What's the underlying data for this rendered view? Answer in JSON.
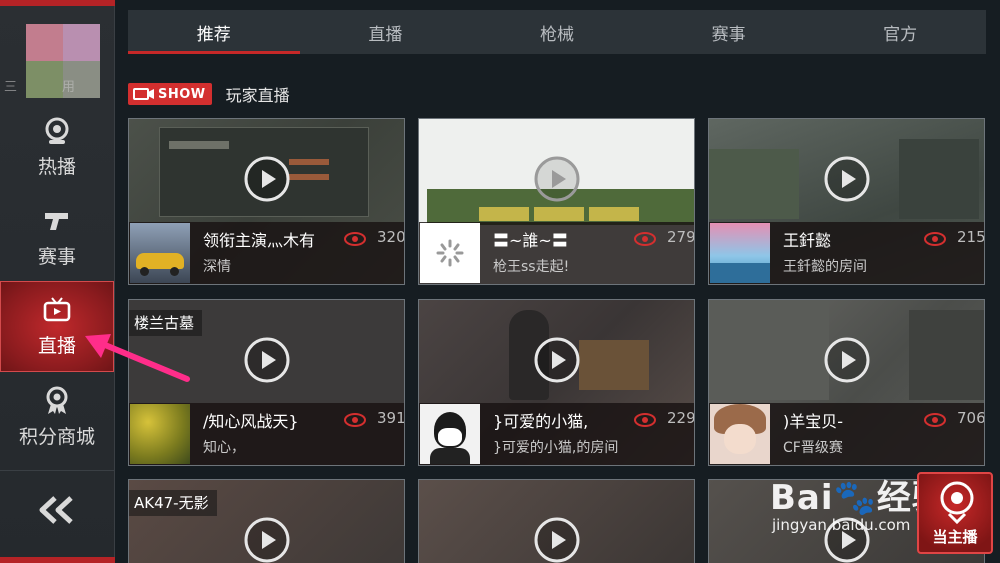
{
  "sidebar": {
    "avatar_name": "三       用",
    "items": [
      {
        "label": "热播",
        "icon": "webcam-icon"
      },
      {
        "label": "赛事",
        "icon": "pistol-icon"
      },
      {
        "label": "直播",
        "icon": "tv-icon",
        "active": true
      },
      {
        "label": "积分商城",
        "icon": "medal-icon"
      }
    ],
    "collapse_icon": "double-chevron-left-icon"
  },
  "tabs": [
    {
      "label": "推荐",
      "active": true
    },
    {
      "label": "直播"
    },
    {
      "label": "枪械"
    },
    {
      "label": "赛事"
    },
    {
      "label": "官方"
    }
  ],
  "section": {
    "badge": "SHOW",
    "title": "玩家直播"
  },
  "cards": [
    {
      "title": "领衔主演灬木有",
      "subtitle": "深情",
      "views": "320"
    },
    {
      "title": "〓~誰~〓",
      "subtitle": "枪王ss走起!",
      "views": "279"
    },
    {
      "title": "王釺懿",
      "subtitle": "王釺懿的房间",
      "views": "215"
    },
    {
      "tag": "楼兰古墓",
      "title": "/知心风战天}",
      "subtitle": "知心，",
      "views": "391"
    },
    {
      "title": "}可爱的小猫,",
      "subtitle": "}可爱的小猫,的房间",
      "views": "229"
    },
    {
      "title": ")羊宝贝-",
      "subtitle": "CF晋级赛",
      "views": "706"
    },
    {
      "tag": "AK47-无影"
    },
    {},
    {}
  ],
  "watermark": {
    "logo": "Bai🐾经验",
    "url": "jingyan.baidu.com"
  },
  "host_button": {
    "label": "当主播"
  },
  "colors": {
    "accent": "#c62828",
    "background": "#161d22",
    "tab_bar": "#2c3338"
  }
}
